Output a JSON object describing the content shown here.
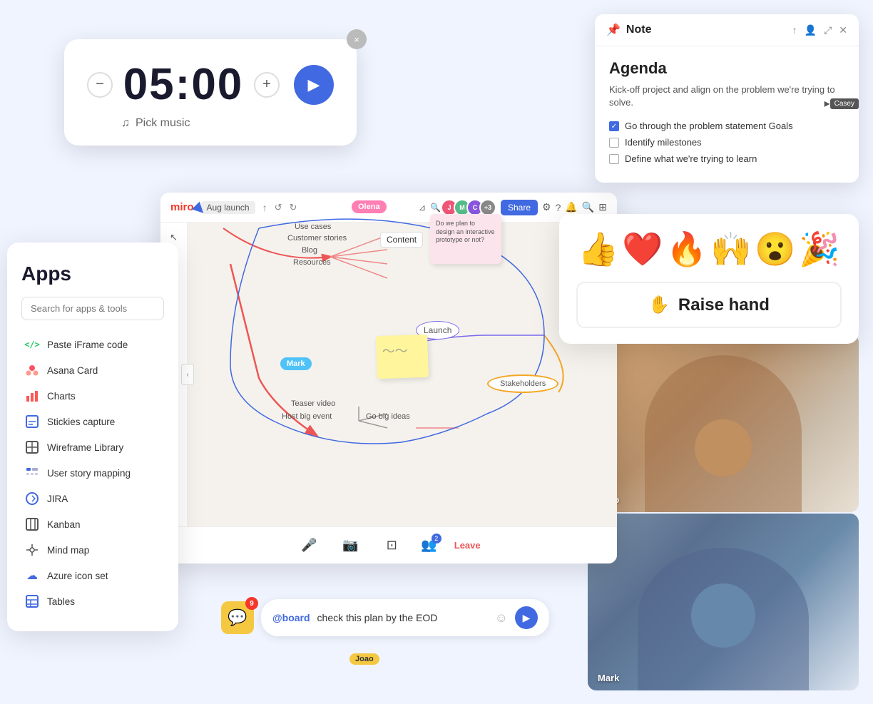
{
  "timer": {
    "time": "05:00",
    "music_label": "Pick music",
    "decrement_label": "−",
    "increment_label": "+",
    "close_label": "×"
  },
  "note": {
    "title_label": "Note",
    "agenda_title": "Agenda",
    "agenda_subtitle": "Kick-off project and align on the problem we're trying to solve.",
    "item1": "Go through the problem statement Goals",
    "item2": "Identify milestones",
    "item3": "Define what we're trying to learn",
    "cursor_user": "Casey"
  },
  "apps": {
    "panel_title": "Apps",
    "search_placeholder": "Search for apps & tools",
    "items": [
      {
        "label": "Paste iFrame code",
        "icon": "</>"
      },
      {
        "label": "Asana Card",
        "icon": "❋"
      },
      {
        "label": "Charts",
        "icon": "📊"
      },
      {
        "label": "Stickies capture",
        "icon": "⊡"
      },
      {
        "label": "Wireframe Library",
        "icon": "⊠"
      },
      {
        "label": "User story mapping",
        "icon": "🗂"
      },
      {
        "label": "JIRA",
        "icon": "⟳"
      },
      {
        "label": "Kanban",
        "icon": "⊟"
      },
      {
        "label": "Mind map",
        "icon": "⊛"
      },
      {
        "label": "Azure icon set",
        "icon": "☁"
      },
      {
        "label": "Tables",
        "icon": "⊞"
      }
    ]
  },
  "miro": {
    "logo": "miro",
    "launch_label": "Aug launch",
    "share_label": "Share",
    "nodes": [
      "Use cases",
      "Customer stories",
      "Blog",
      "Resources",
      "Content",
      "Launch",
      "Stakeholders",
      "Go big ideas",
      "Host big event",
      "Teaser video"
    ]
  },
  "emoji_panel": {
    "emojis": [
      "👍",
      "❤️",
      "🔥",
      "🙌",
      "😮",
      "🎉"
    ],
    "raise_hand_label": "Raise hand"
  },
  "videos": {
    "joao_label": "Joao",
    "mark_label": "Mark"
  },
  "chat": {
    "notification_count": "9",
    "at_text": "@board",
    "message_text": "check this plan by the EOD",
    "joao_cursor": "Joao"
  },
  "board_tags": {
    "olena": "Olena",
    "mark": "Mark"
  }
}
